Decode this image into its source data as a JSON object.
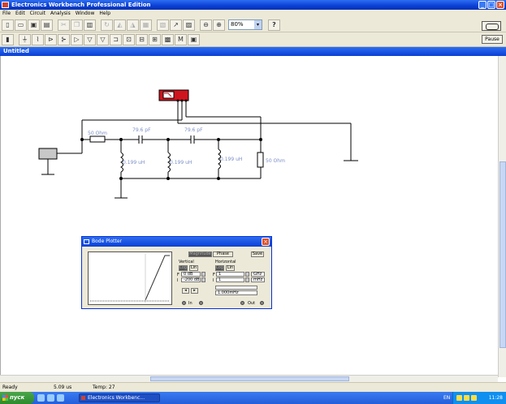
{
  "app": {
    "title": "Electronics Workbench Professional Edition",
    "document_title": "Untitled"
  },
  "menu": [
    "File",
    "Edit",
    "Circuit",
    "Analysis",
    "Window",
    "Help"
  ],
  "toolbar": {
    "zoom": "80%",
    "help": "?",
    "pause": "Pause",
    "part_bins": [
      "M"
    ]
  },
  "circuit": {
    "labels": {
      "r1": "50  Ohm",
      "c1": "79.6 pF",
      "c2": "79.6 pF",
      "l1": "0.199 uH",
      "l2": "0.199 uH",
      "l3": "0.199 uH",
      "r2": "50  Ohm"
    }
  },
  "bode": {
    "title": "Bode Plotter",
    "magnitude": "Magnitude",
    "phase": "Phase",
    "save": "Save",
    "vertical": "Vertical",
    "horizontal": "Horizontal",
    "log": "Log",
    "lin": "Lin",
    "v_f_label": "F",
    "v_i_label": "I",
    "h_f_label": "F",
    "h_i_label": "I",
    "v_f_value": "0 dB",
    "v_i_value": "-200 dB",
    "h_f_value": "1",
    "h_i_value": "1",
    "h_f_unit": "GHz",
    "h_i_unit": "mHz",
    "readout": "1.000mHz",
    "in": "In",
    "out": "Out"
  },
  "status": {
    "state": "Ready",
    "time": "5.09 us",
    "temp": "Temp:  27"
  },
  "taskbar": {
    "start": "пуск",
    "item": "Electronics Workbenc...",
    "lang": "EN",
    "clock": "11:28"
  },
  "colors": {
    "titlebar": "#0a3fd6",
    "instrument_red": "#d0141e",
    "label_blue": "#7b8fc7"
  }
}
